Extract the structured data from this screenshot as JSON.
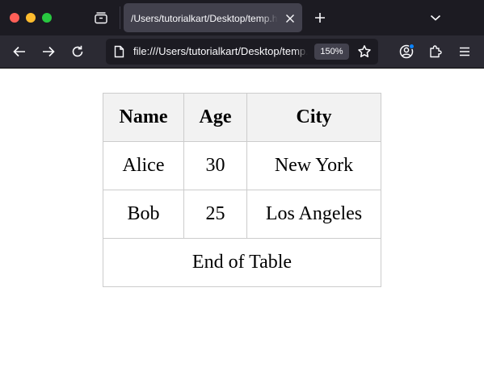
{
  "browser": {
    "tab": {
      "title": "/Users/tutorialkart/Desktop/temp.html",
      "close_icon": "close-icon"
    },
    "icons": {
      "tab_list": "tab-list-icon",
      "new_tab": "plus-icon",
      "tab_overflow": "chevron-down-icon",
      "back": "back-arrow-icon",
      "forward": "forward-arrow-icon",
      "reload": "reload-icon",
      "page": "page-icon",
      "bookmark": "star-icon",
      "account": "account-icon",
      "extensions": "puzzle-icon",
      "menu": "hamburger-menu-icon"
    },
    "url": "file:///Users/tutorialkart/Desktop/temp.html",
    "zoom": "150%",
    "colors": {
      "tabstrip_bg": "#1c1b22",
      "toolbar_bg": "#2b2a33",
      "active_tab_bg": "#42414d",
      "urlbar_bg": "#1c1b22",
      "text": "#fbfbfe",
      "traffic_close": "#ff5f57",
      "traffic_minimize": "#febc2e",
      "traffic_maximize": "#28c840",
      "account_badge": "#0a84ff"
    }
  },
  "page": {
    "table": {
      "headers": [
        "Name",
        "Age",
        "City"
      ],
      "rows": [
        [
          "Alice",
          "30",
          "New York"
        ],
        [
          "Bob",
          "25",
          "Los Angeles"
        ]
      ],
      "footer": "End of Table",
      "colors": {
        "header_bg": "#f2f2f2",
        "border": "#cccccc",
        "text": "#000000"
      }
    }
  }
}
